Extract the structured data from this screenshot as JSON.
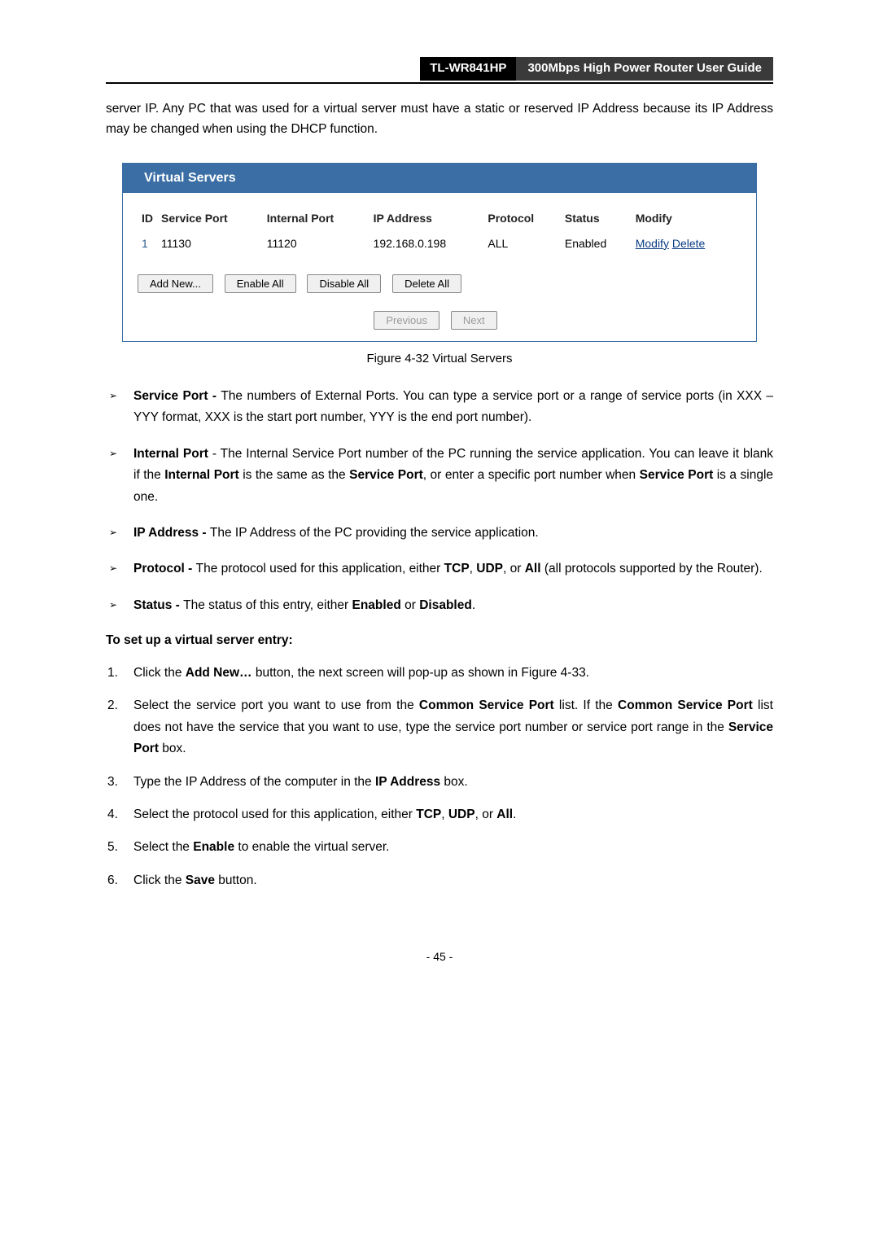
{
  "header": {
    "model": "TL-WR841HP",
    "guide_title": "300Mbps High Power Router User Guide"
  },
  "intro_text": "server IP. Any PC that was used for a virtual server must have a static or reserved IP Address because its IP Address may be changed when using the DHCP function.",
  "vs": {
    "title": "Virtual Servers",
    "columns": {
      "id": "ID",
      "service_port": "Service Port",
      "internal_port": "Internal Port",
      "ip_address": "IP Address",
      "protocol": "Protocol",
      "status": "Status",
      "modify": "Modify"
    },
    "row": {
      "idx": "1",
      "service_port": "11130",
      "internal_port": "11120",
      "ip_address": "192.168.0.198",
      "protocol": "ALL",
      "status": "Enabled",
      "modify_link": "Modify",
      "delete_link": "Delete"
    },
    "buttons": {
      "add_new": "Add New...",
      "enable_all": "Enable All",
      "disable_all": "Disable All",
      "delete_all": "Delete All",
      "previous": "Previous",
      "next": "Next"
    }
  },
  "figure_caption": "Figure 4-32    Virtual Servers",
  "bullets": {
    "service_port": {
      "label": "Service Port - ",
      "text": "The numbers of External Ports. You can type a service port or a range of service ports (in XXX – YYY format, XXX is the start port number, YYY is the end port number)."
    },
    "internal_port": {
      "label": "Internal Port",
      "t1": " - The Internal Service Port number of the PC running the service application. You can leave it blank if the ",
      "b1": "Internal Port",
      "t2": " is the same as the ",
      "b2": "Service Port",
      "t3": ", or enter a specific port number when ",
      "b3": "Service Port",
      "t4": " is a single one."
    },
    "ip_address": {
      "label": "IP Address - ",
      "text": "The IP Address of the PC providing the service application."
    },
    "protocol": {
      "label": "Protocol - ",
      "t1": "The protocol used for this application, either ",
      "b1": "TCP",
      "c1": ", ",
      "b2": "UDP",
      "c2": ", or ",
      "b3": "All",
      "t2": " (all protocols supported by the Router)."
    },
    "status": {
      "label": "Status - ",
      "t1": "The status of this entry, either ",
      "b1": "Enabled",
      "c1": " or ",
      "b2": "Disabled",
      "t2": "."
    }
  },
  "instr_heading": "To set up a virtual server entry:",
  "steps": {
    "s1": {
      "t1": "Click the ",
      "b1": "Add New…",
      "t2": " button, the next screen will pop-up as shown in Figure 4-33."
    },
    "s2": {
      "t1": "Select the service port you want to use from the ",
      "b1": "Common Service Port",
      "t2": " list. If the ",
      "b2": "Common Service Port",
      "t3": " list does not have the service that you want to use, type the service port number or service port range in the ",
      "b3": "Service Port",
      "t4": " box."
    },
    "s3": {
      "t1": "Type the IP Address of the computer in the ",
      "b1": "IP Address",
      "t2": " box."
    },
    "s4": {
      "t1": "Select the protocol used for this application, either ",
      "b1": "TCP",
      "c1": ", ",
      "b2": "UDP",
      "c2": ", or ",
      "b3": "All",
      "t2": "."
    },
    "s5": {
      "t1": "Select the ",
      "b1": "Enable",
      "t2": " to enable the virtual server."
    },
    "s6": {
      "t1": "Click the ",
      "b1": "Save",
      "t2": " button."
    }
  },
  "page_number": "- 45 -"
}
